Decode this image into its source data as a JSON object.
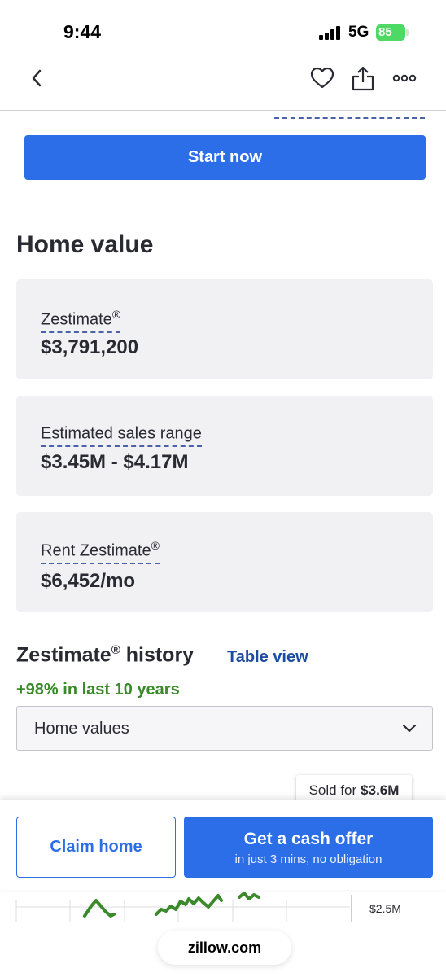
{
  "status_bar": {
    "time": "9:44",
    "network": "5G",
    "battery": "85"
  },
  "nav": {
    "back_icon": "chevron-left-icon",
    "favorite_icon": "heart-icon",
    "share_icon": "share-icon",
    "more_icon": "more-icon"
  },
  "cta": {
    "start_label": "Start now"
  },
  "home_value": {
    "title": "Home value",
    "cards": [
      {
        "label": "Zestimate",
        "mark": "®",
        "value": "$3,791,200"
      },
      {
        "label": "Estimated sales range",
        "mark": "",
        "value": "$3.45M - $4.17M"
      },
      {
        "label": "Rent Zestimate",
        "mark": "®",
        "value": "$6,452/mo"
      }
    ]
  },
  "history": {
    "title_prefix": "Zestimate",
    "title_mark": "®",
    "title_suffix": " history",
    "table_view_label": "Table view",
    "change": "+98% in last 10 years",
    "select_value": "Home values",
    "tooltip_prefix": "Sold for",
    "tooltip_value": "$3.6M",
    "axis_label": "$2.5M"
  },
  "actions": {
    "claim_label": "Claim home",
    "cash_label": "Get a cash offer",
    "cash_sub": "in just 3 mins, no obligation"
  },
  "browser": {
    "url": "zillow.com"
  },
  "colors": {
    "primary": "#2b6ee8",
    "link": "#1d4da0",
    "positive": "#3a8a2a",
    "card_bg": "#f1f1f4"
  }
}
